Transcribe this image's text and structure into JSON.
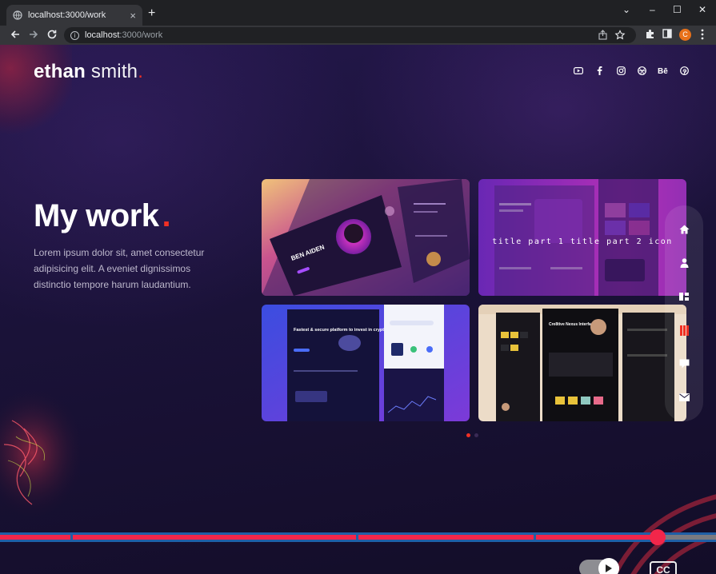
{
  "browser": {
    "tab_title": "localhost:3000/work",
    "tab_close": "×",
    "new_tab": "+",
    "url_host": "localhost",
    "url_path": ":3000/work",
    "profile_initial": "C",
    "window_controls": [
      "⌄",
      "–",
      "☐",
      "✕"
    ]
  },
  "site": {
    "logo_bold": "ethan",
    "logo_light": "smith",
    "logo_dot": ".",
    "accent_color": "#f13024",
    "socials": [
      "youtube-icon",
      "facebook-icon",
      "instagram-icon",
      "dribbble-icon",
      "behance-icon",
      "pinterest-icon"
    ]
  },
  "work": {
    "heading": "My work",
    "heading_dot": ".",
    "description": "Lorem ipsum dolor sit, amet consectetur adipisicing elit. A eveniet dignissimos distinctio tempore harum laudantium.",
    "hover_title": "title part 1 title part 2 icon",
    "card1_name": "BEN AIDEN",
    "card3_heading": "Fastest & secure platform to invest in crypto",
    "card4_heading": "Cre8tive Nexus Interfaces",
    "pagination": {
      "count": 2,
      "active": 0
    }
  },
  "sidenav": [
    "home-icon",
    "user-icon",
    "services-icon",
    "work-icon",
    "testimonials-icon",
    "contact-icon"
  ],
  "player": {
    "played_fraction": 0.918,
    "cc_label": "CC"
  }
}
